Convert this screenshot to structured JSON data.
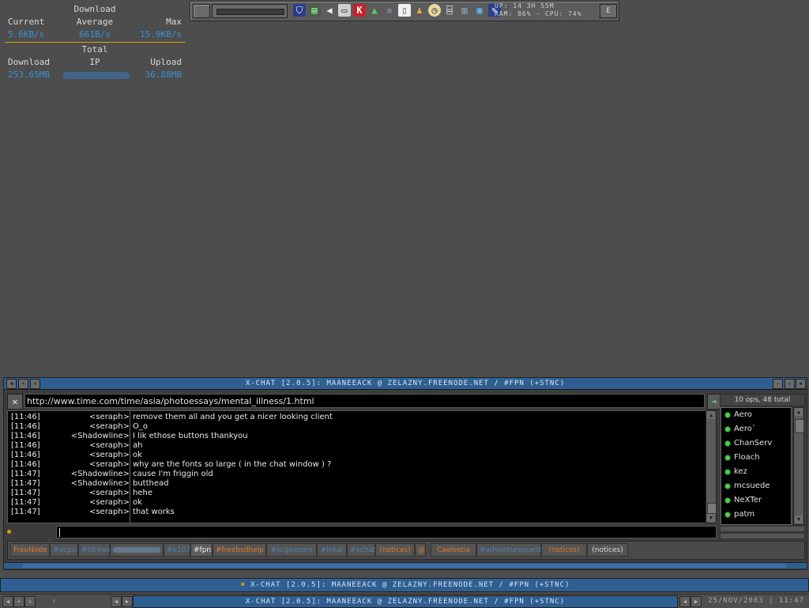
{
  "netmon": {
    "title_download": "Download",
    "col_current": "Current",
    "col_average": "Average",
    "col_max": "Max",
    "current": "5.6KB/s",
    "average": "661B/s",
    "max": "15.9KB/s",
    "title_total": "Total",
    "col_download": "Download",
    "col_ip": "IP",
    "col_upload": "Upload",
    "download_total": "253.65MB",
    "upload_total": "36.88MB"
  },
  "toppanel": {
    "icons": [
      "shield-icon",
      "terminal-icon",
      "speaker-icon",
      "monitor-icon",
      "k-app-icon",
      "eye-icon",
      "settings-icon",
      "document-icon",
      "head-icon",
      "clock-icon",
      "network-icon",
      "trash-icon",
      "computer-icon",
      "gimp-icon"
    ],
    "stats_line1": "UP: 14 3H 55M",
    "stats_line2": "RAM: 86% - CPU: 74%",
    "e_label": "E"
  },
  "xchat": {
    "title": "X-CHAT [2.0.5]: MAANEEACK @ ZELAZNY.FREENODE.NET / #FPN (+STNC)",
    "topic": "http://www.time.com/time/asia/photoessays/mental_illness/1.html",
    "user_count": "10 ops, 48 total",
    "messages": [
      {
        "time": "[11:46]",
        "nick": "<seraph>",
        "text": "remove them all and you get a nicer looking client"
      },
      {
        "time": "[11:46]",
        "nick": "<seraph>",
        "text": "O_o"
      },
      {
        "time": "[11:46]",
        "nick": "<Shadowline>",
        "text": "I lik ethose buttons thankyou"
      },
      {
        "time": "[11:46]",
        "nick": "<seraph>",
        "text": "ah"
      },
      {
        "time": "[11:46]",
        "nick": "<seraph>",
        "text": "ok"
      },
      {
        "time": "[11:46]",
        "nick": "<seraph>",
        "text": "why are the fonts so large ( in the chat window ) ?"
      },
      {
        "time": "[11:47]",
        "nick": "<Shadowline>",
        "text": "cause I'm friggin old"
      },
      {
        "time": "[11:47]",
        "nick": "<Shadowline>",
        "text": "butthead"
      },
      {
        "time": "[11:47]",
        "nick": "<seraph>",
        "text": "hehe"
      },
      {
        "time": "[11:47]",
        "nick": "<seraph>",
        "text": "ok"
      },
      {
        "time": "[11:47]",
        "nick": "<seraph>",
        "text": "that works"
      }
    ],
    "users": [
      "Aero",
      "Aero`",
      "ChanServ",
      "Floach",
      "kez",
      "mcsuede",
      "NeXTer",
      "patm"
    ],
    "nick": "maaneeack",
    "tabs": [
      {
        "label": "FreeNode",
        "style": "orange"
      },
      {
        "label": "#acpu",
        "style": "dim"
      },
      {
        "label": "#bb4win",
        "style": "dim"
      },
      {
        "label": "",
        "style": "blur"
      },
      {
        "label": "#e107",
        "style": "dim"
      },
      {
        "label": "#fpn",
        "style": "active"
      },
      {
        "label": "#freebsdhelp",
        "style": "orange"
      },
      {
        "label": "#ls.geezers",
        "style": "dim"
      },
      {
        "label": "#lokal",
        "style": "dim"
      },
      {
        "label": "#xchat",
        "style": "dim"
      },
      {
        "label": "(notices)",
        "style": "orange"
      },
      {
        "label": "@",
        "style": "orange"
      },
      {
        "label": "Caelestia",
        "style": "orange"
      },
      {
        "label": "#adventurequest",
        "style": "dim"
      },
      {
        "label": "(notices)",
        "style": "orange"
      },
      {
        "label": "(notices)",
        "style": "plain"
      }
    ]
  },
  "taskbar": {
    "task_title": "X-CHAT [2.0.5]: MAANEEACK @ ZELAZNY.FREENODE.NET / #FPN (+STNC)",
    "task_title2": "X-CHAT [2.0.5]: MAANEEACK @ ZELAZNY.FREENODE.NET / #FPN (+STNC)",
    "clock": "25/NOV/2003 | 11:47"
  }
}
